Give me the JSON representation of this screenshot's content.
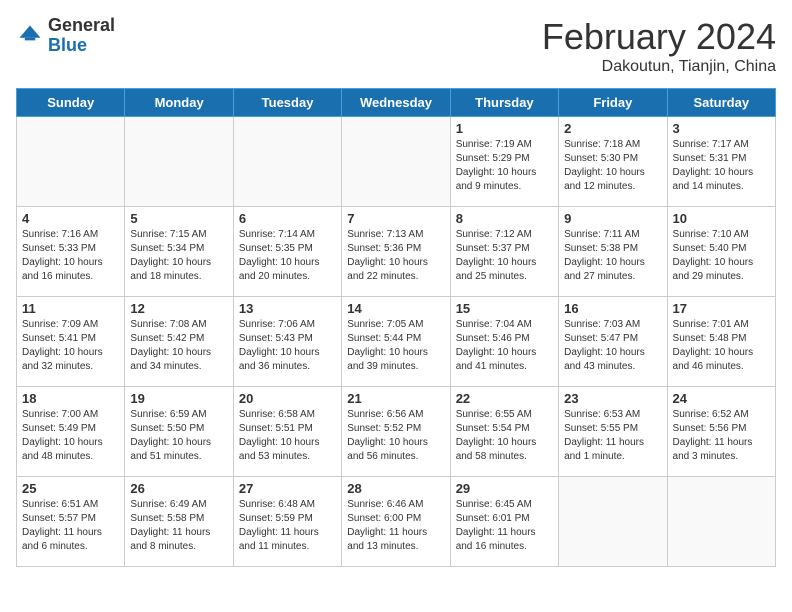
{
  "header": {
    "logo_general": "General",
    "logo_blue": "Blue",
    "title": "February 2024",
    "subtitle": "Dakoutun, Tianjin, China"
  },
  "weekdays": [
    "Sunday",
    "Monday",
    "Tuesday",
    "Wednesday",
    "Thursday",
    "Friday",
    "Saturday"
  ],
  "weeks": [
    [
      {
        "day": "",
        "info": ""
      },
      {
        "day": "",
        "info": ""
      },
      {
        "day": "",
        "info": ""
      },
      {
        "day": "",
        "info": ""
      },
      {
        "day": "1",
        "info": "Sunrise: 7:19 AM\nSunset: 5:29 PM\nDaylight: 10 hours\nand 9 minutes."
      },
      {
        "day": "2",
        "info": "Sunrise: 7:18 AM\nSunset: 5:30 PM\nDaylight: 10 hours\nand 12 minutes."
      },
      {
        "day": "3",
        "info": "Sunrise: 7:17 AM\nSunset: 5:31 PM\nDaylight: 10 hours\nand 14 minutes."
      }
    ],
    [
      {
        "day": "4",
        "info": "Sunrise: 7:16 AM\nSunset: 5:33 PM\nDaylight: 10 hours\nand 16 minutes."
      },
      {
        "day": "5",
        "info": "Sunrise: 7:15 AM\nSunset: 5:34 PM\nDaylight: 10 hours\nand 18 minutes."
      },
      {
        "day": "6",
        "info": "Sunrise: 7:14 AM\nSunset: 5:35 PM\nDaylight: 10 hours\nand 20 minutes."
      },
      {
        "day": "7",
        "info": "Sunrise: 7:13 AM\nSunset: 5:36 PM\nDaylight: 10 hours\nand 22 minutes."
      },
      {
        "day": "8",
        "info": "Sunrise: 7:12 AM\nSunset: 5:37 PM\nDaylight: 10 hours\nand 25 minutes."
      },
      {
        "day": "9",
        "info": "Sunrise: 7:11 AM\nSunset: 5:38 PM\nDaylight: 10 hours\nand 27 minutes."
      },
      {
        "day": "10",
        "info": "Sunrise: 7:10 AM\nSunset: 5:40 PM\nDaylight: 10 hours\nand 29 minutes."
      }
    ],
    [
      {
        "day": "11",
        "info": "Sunrise: 7:09 AM\nSunset: 5:41 PM\nDaylight: 10 hours\nand 32 minutes."
      },
      {
        "day": "12",
        "info": "Sunrise: 7:08 AM\nSunset: 5:42 PM\nDaylight: 10 hours\nand 34 minutes."
      },
      {
        "day": "13",
        "info": "Sunrise: 7:06 AM\nSunset: 5:43 PM\nDaylight: 10 hours\nand 36 minutes."
      },
      {
        "day": "14",
        "info": "Sunrise: 7:05 AM\nSunset: 5:44 PM\nDaylight: 10 hours\nand 39 minutes."
      },
      {
        "day": "15",
        "info": "Sunrise: 7:04 AM\nSunset: 5:46 PM\nDaylight: 10 hours\nand 41 minutes."
      },
      {
        "day": "16",
        "info": "Sunrise: 7:03 AM\nSunset: 5:47 PM\nDaylight: 10 hours\nand 43 minutes."
      },
      {
        "day": "17",
        "info": "Sunrise: 7:01 AM\nSunset: 5:48 PM\nDaylight: 10 hours\nand 46 minutes."
      }
    ],
    [
      {
        "day": "18",
        "info": "Sunrise: 7:00 AM\nSunset: 5:49 PM\nDaylight: 10 hours\nand 48 minutes."
      },
      {
        "day": "19",
        "info": "Sunrise: 6:59 AM\nSunset: 5:50 PM\nDaylight: 10 hours\nand 51 minutes."
      },
      {
        "day": "20",
        "info": "Sunrise: 6:58 AM\nSunset: 5:51 PM\nDaylight: 10 hours\nand 53 minutes."
      },
      {
        "day": "21",
        "info": "Sunrise: 6:56 AM\nSunset: 5:52 PM\nDaylight: 10 hours\nand 56 minutes."
      },
      {
        "day": "22",
        "info": "Sunrise: 6:55 AM\nSunset: 5:54 PM\nDaylight: 10 hours\nand 58 minutes."
      },
      {
        "day": "23",
        "info": "Sunrise: 6:53 AM\nSunset: 5:55 PM\nDaylight: 11 hours\nand 1 minute."
      },
      {
        "day": "24",
        "info": "Sunrise: 6:52 AM\nSunset: 5:56 PM\nDaylight: 11 hours\nand 3 minutes."
      }
    ],
    [
      {
        "day": "25",
        "info": "Sunrise: 6:51 AM\nSunset: 5:57 PM\nDaylight: 11 hours\nand 6 minutes."
      },
      {
        "day": "26",
        "info": "Sunrise: 6:49 AM\nSunset: 5:58 PM\nDaylight: 11 hours\nand 8 minutes."
      },
      {
        "day": "27",
        "info": "Sunrise: 6:48 AM\nSunset: 5:59 PM\nDaylight: 11 hours\nand 11 minutes."
      },
      {
        "day": "28",
        "info": "Sunrise: 6:46 AM\nSunset: 6:00 PM\nDaylight: 11 hours\nand 13 minutes."
      },
      {
        "day": "29",
        "info": "Sunrise: 6:45 AM\nSunset: 6:01 PM\nDaylight: 11 hours\nand 16 minutes."
      },
      {
        "day": "",
        "info": ""
      },
      {
        "day": "",
        "info": ""
      }
    ]
  ]
}
